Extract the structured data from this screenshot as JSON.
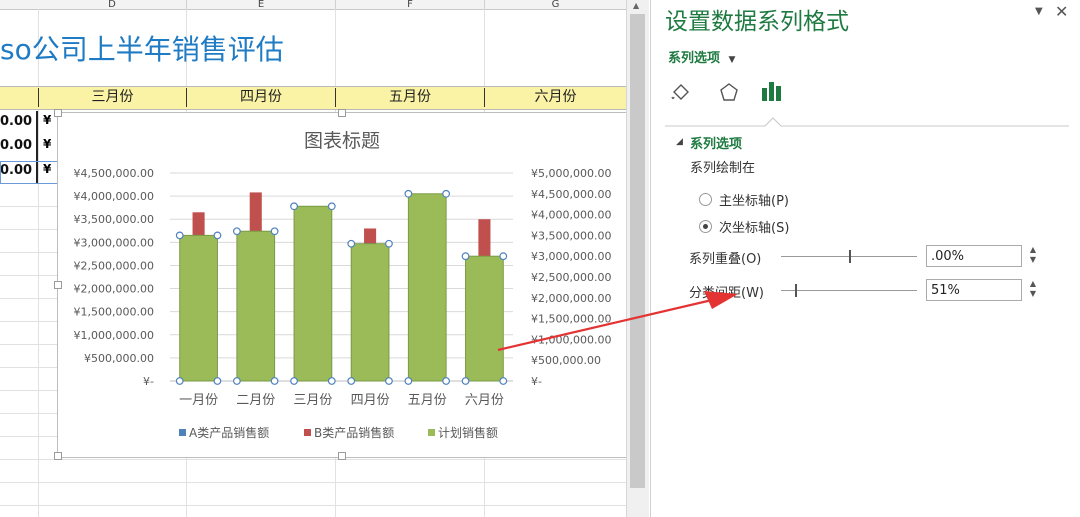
{
  "sheet": {
    "columns": [
      "D",
      "E",
      "F",
      "G"
    ],
    "title": "so公司上半年销售评估",
    "month_headers": [
      "三月份",
      "四月份",
      "五月份",
      "六月份"
    ],
    "cut_values": [
      "0.00",
      "0.00",
      "0.00"
    ],
    "cut_currency": "¥"
  },
  "chart": {
    "title_text": "图表标题"
  },
  "chart_data": {
    "type": "bar",
    "title": "图表标题",
    "categories": [
      "一月份",
      "二月份",
      "三月份",
      "四月份",
      "五月份",
      "六月份"
    ],
    "y_ticks_primary": [
      "¥4,500,000.00",
      "¥4,000,000.00",
      "¥3,500,000.00",
      "¥3,000,000.00",
      "¥2,500,000.00",
      "¥2,000,000.00",
      "¥1,500,000.00",
      "¥1,000,000.00",
      "¥500,000.00",
      "¥-"
    ],
    "y_ticks_secondary": [
      "¥5,000,000.00",
      "¥4,500,000.00",
      "¥4,000,000.00",
      "¥3,500,000.00",
      "¥3,000,000.00",
      "¥2,500,000.00",
      "¥2,000,000.00",
      "¥1,500,000.00",
      "¥1,000,000.00",
      "¥500,000.00",
      "¥-"
    ],
    "ylim_primary": [
      0,
      4500000
    ],
    "ylim_secondary": [
      0,
      5000000
    ],
    "series": [
      {
        "name": "A类产品销售额",
        "color": "#4f81bd",
        "axis": "primary",
        "values": [
          3140000,
          3230000,
          3780000,
          2980000,
          4050000,
          2680000
        ]
      },
      {
        "name": "B类产品销售额",
        "color": "#c0504d",
        "axis": "primary",
        "values": [
          3650000,
          4080000,
          3400000,
          3300000,
          3700000,
          3500000
        ]
      },
      {
        "name": "计划销售额",
        "color": "#9bbb59",
        "axis": "secondary",
        "values": [
          3500000,
          3600000,
          4200000,
          3300000,
          4500000,
          3000000
        ]
      }
    ],
    "legend_position": "bottom",
    "gridlines": true
  },
  "pane": {
    "title": "设置数据系列格式",
    "dropdown_label": "系列选项",
    "section_title": "系列选项",
    "plot_on_label": "系列绘制在",
    "primary_axis_label": "主坐标轴(P)",
    "secondary_axis_label": "次坐标轴(S)",
    "overlap_label": "系列重叠(O)",
    "overlap_value": ".00%",
    "overlap_level": 0.5,
    "gap_label": "分类间距(W)",
    "gap_value": "51%",
    "gap_level": 0.1
  },
  "colors": {
    "accent_green": "#1e7a41",
    "title_blue": "#1f7bc4",
    "arrow_red": "#e33333"
  }
}
